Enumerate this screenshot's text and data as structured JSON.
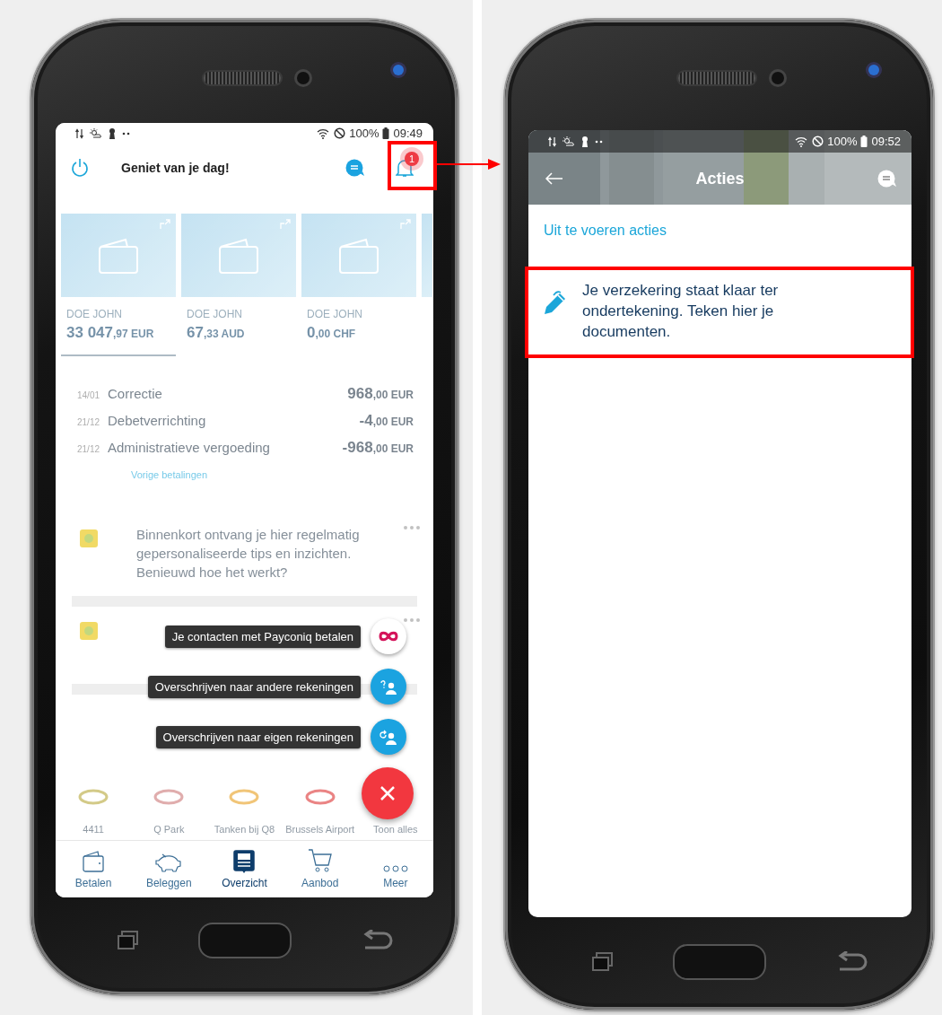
{
  "left_screen": {
    "status_bar": {
      "battery": "100%",
      "time": "09:49"
    },
    "header": {
      "greeting": "Geniet van je dag!",
      "notifications": "1"
    },
    "accounts": [
      {
        "holder": "DOE JOHN",
        "balance_whole": "33 047",
        "balance_fraction": ",97 EUR",
        "selected": true
      },
      {
        "holder": "DOE JOHN",
        "balance_whole": "67",
        "balance_fraction": ",33 AUD",
        "selected": false
      },
      {
        "holder": "DOE JOHN",
        "balance_whole": "0",
        "balance_fraction": ",00 CHF",
        "selected": false
      }
    ],
    "transactions": [
      {
        "date": "14/01",
        "description": "Correctie",
        "amount_whole": "968",
        "amount_fraction": ",00 EUR"
      },
      {
        "date": "21/12",
        "description": "Debetverrichting",
        "amount_whole": "-4",
        "amount_fraction": ",00 EUR"
      },
      {
        "date": "21/12",
        "description": "Administratieve vergoeding",
        "amount_whole": "-968",
        "amount_fraction": ",00 EUR"
      }
    ],
    "history_link": "Vorige betalingen",
    "tips": [
      {
        "text": "Binnenkort ontvang je hier regelmatig gepersonaliseerde tips en inzichten. Benieuwd hoe het werkt?"
      }
    ],
    "shortcuts": [
      {
        "label": "4411"
      },
      {
        "label": "Q Park"
      },
      {
        "label": "Tanken bij Q8"
      },
      {
        "label": "Brussels Airport"
      },
      {
        "label": "Toon alles"
      }
    ],
    "fab_menu": {
      "open": true,
      "actions": [
        {
          "kind": "payconiq",
          "label": "Je contacten met Payconiq betalen"
        },
        {
          "kind": "transfer_other",
          "label": "Overschrijven naar andere rekeningen"
        },
        {
          "kind": "transfer_own",
          "label": "Overschrijven naar eigen rekeningen"
        }
      ]
    },
    "nav": [
      {
        "kind": "wallet",
        "label": "Betalen",
        "selected": false
      },
      {
        "kind": "piggy",
        "label": "Beleggen",
        "selected": false
      },
      {
        "kind": "overview",
        "label": "Overzicht",
        "selected": true
      },
      {
        "kind": "cart",
        "label": "Aanbod",
        "selected": false
      },
      {
        "kind": "more",
        "label": "Meer",
        "selected": false
      }
    ]
  },
  "right_screen": {
    "status_bar": {
      "battery": "100%",
      "time": "09:52"
    },
    "title": "Acties",
    "section": "Uit te voeren acties",
    "actions": [
      {
        "text": "Je verzekering staat klaar ter ondertekening. Teken hier je documenten."
      }
    ]
  }
}
